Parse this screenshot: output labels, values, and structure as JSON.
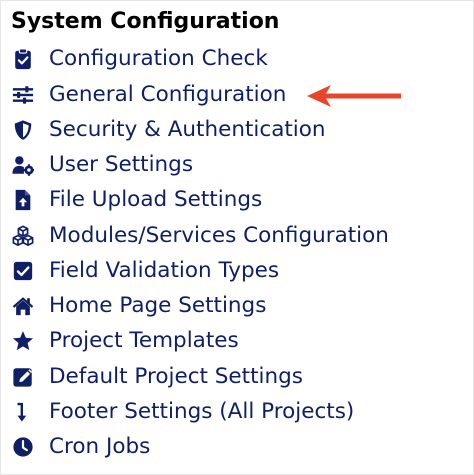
{
  "menu": {
    "title": "System Configuration",
    "items": [
      {
        "label": "Configuration Check",
        "icon": "clipboard-check-icon"
      },
      {
        "label": "General Configuration",
        "icon": "sliders-icon"
      },
      {
        "label": "Security & Authentication",
        "icon": "shield-icon"
      },
      {
        "label": "User Settings",
        "icon": "users-cog-icon"
      },
      {
        "label": "File Upload Settings",
        "icon": "file-upload-icon"
      },
      {
        "label": "Modules/Services Configuration",
        "icon": "cubes-icon"
      },
      {
        "label": "Field Validation Types",
        "icon": "check-square-icon"
      },
      {
        "label": "Home Page Settings",
        "icon": "home-icon"
      },
      {
        "label": "Project Templates",
        "icon": "star-icon"
      },
      {
        "label": "Default Project Settings",
        "icon": "edit-icon"
      },
      {
        "label": "Footer Settings (All Projects)",
        "icon": "level-down-icon"
      },
      {
        "label": "Cron Jobs",
        "icon": "clock-icon"
      }
    ]
  },
  "annotation": {
    "arrow_color": "#e8452f",
    "arrow_target": "General Configuration"
  },
  "colors": {
    "icon": "#0f1f66",
    "label": "#0f1f66",
    "title": "#000000"
  }
}
